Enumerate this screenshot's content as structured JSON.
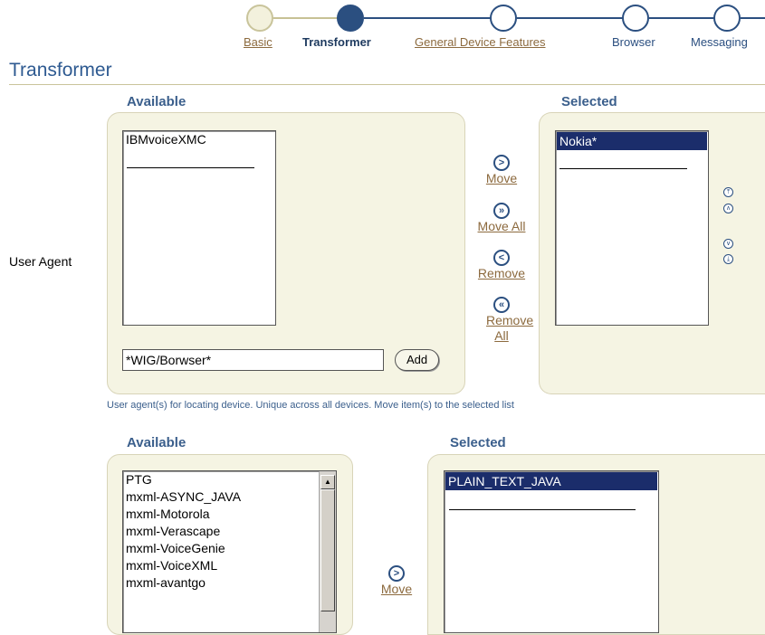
{
  "train": {
    "steps": [
      {
        "label": "Basic",
        "state": "visited"
      },
      {
        "label": "Transformer",
        "state": "current"
      },
      {
        "label": "General Device Features",
        "state": "next"
      },
      {
        "label": "Browser",
        "state": "unvisited"
      },
      {
        "label": "Messaging",
        "state": "unvisited"
      }
    ]
  },
  "page_title": "Transformer",
  "user_agent": {
    "field_label": "User Agent",
    "available_heading": "Available",
    "selected_heading": "Selected",
    "available_items": [
      "IBMvoiceXMC"
    ],
    "selected_items": [
      "Nokia*"
    ],
    "input_value": "*WIG/Borwser*",
    "add_label": "Add",
    "move_label": "Move",
    "move_all_label": "Move All",
    "remove_label": "Remove",
    "remove_all_label": "Remove All",
    "help_text": "User agent(s) for locating device. Unique across all devices. Move item(s) to the selected list"
  },
  "transformer": {
    "available_heading": "Available",
    "selected_heading": "Selected",
    "available_items": [
      "PTG",
      "mxml-ASYNC_JAVA",
      "mxml-Motorola",
      "mxml-Verascape",
      "mxml-VoiceGenie",
      "mxml-VoiceXML",
      "mxml-avantgo"
    ],
    "selected_items": [
      "PLAIN_TEXT_JAVA"
    ],
    "move_label": "Move"
  },
  "icons": {
    "move": ">",
    "move_all": "»",
    "remove": "<",
    "remove_all": "«",
    "top": "⤒",
    "up": "∧",
    "down": "∨",
    "bottom": "⤓"
  },
  "colors": {
    "brand_blue": "#2b4f80",
    "link_brown": "#8c6a3e",
    "selection": "#1b2d6b",
    "panel": "#f5f4e3"
  }
}
